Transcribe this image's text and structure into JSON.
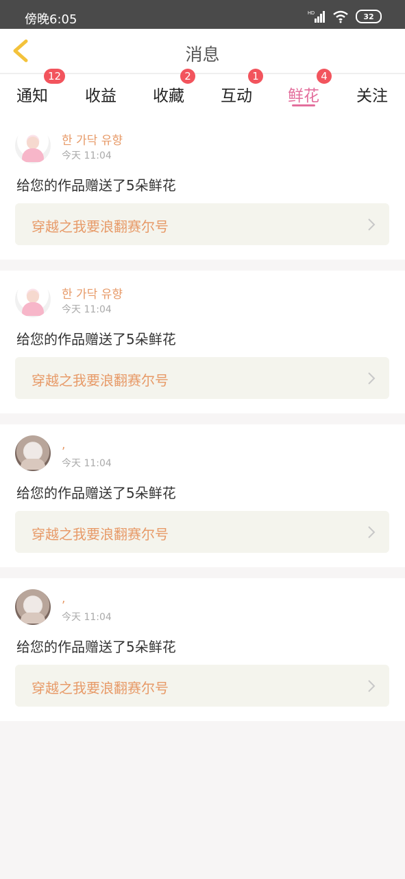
{
  "status_bar": {
    "time": "傍晚6:05",
    "network": "HD",
    "battery": "32"
  },
  "header": {
    "title": "消息"
  },
  "tabs": [
    {
      "label": "通知",
      "badge": "12"
    },
    {
      "label": "收益",
      "badge": ""
    },
    {
      "label": "收藏",
      "badge": "2"
    },
    {
      "label": "互动",
      "badge": "1"
    },
    {
      "label": "鲜花",
      "badge": "4",
      "active": true
    },
    {
      "label": "关注",
      "badge": ""
    }
  ],
  "messages": [
    {
      "user": "한 가닥 유향",
      "time": "今天 11:04",
      "text": "给您的作品赠送了5朵鲜花",
      "work": "穿越之我要浪翻赛尔号"
    },
    {
      "user": "한 가닥 유향",
      "time": "今天 11:04",
      "text": "给您的作品赠送了5朵鲜花",
      "work": "穿越之我要浪翻赛尔号"
    },
    {
      "user": ",",
      "time": "今天 11:04",
      "text": "给您的作品赠送了5朵鲜花",
      "work": "穿越之我要浪翻赛尔号"
    },
    {
      "user": ",",
      "time": "今天 11:04",
      "text": "给您的作品赠送了5朵鲜花",
      "work": "穿越之我要浪翻赛尔号"
    }
  ],
  "colors": {
    "accent": "#e36e9c",
    "badge": "#f2545d",
    "work_text": "#e79a68",
    "status_bar": "#4a4a4a"
  }
}
